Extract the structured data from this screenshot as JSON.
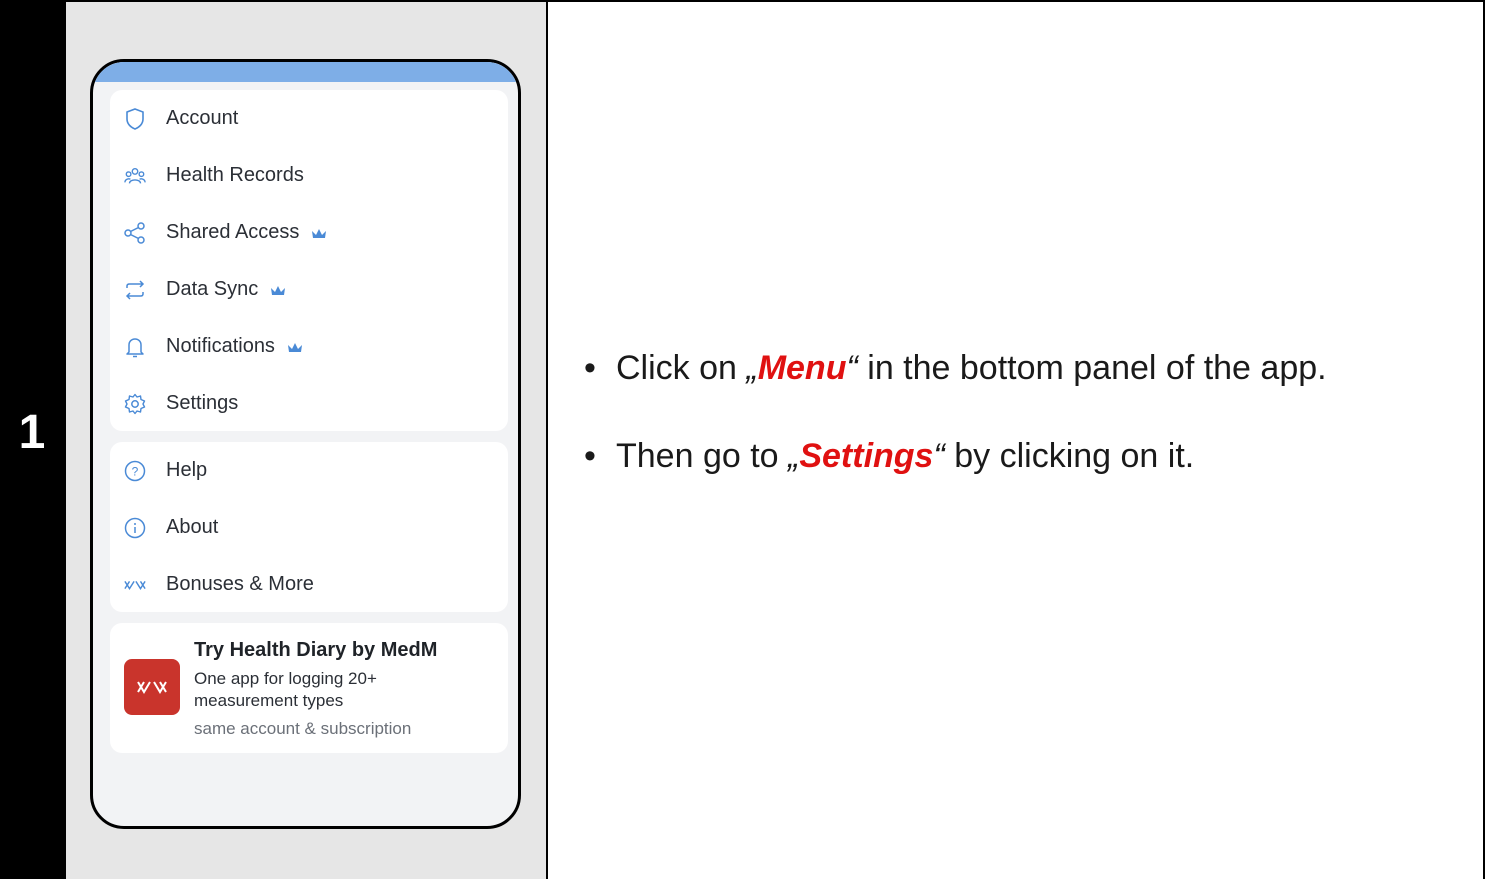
{
  "step": {
    "number": "1"
  },
  "menu": {
    "group1": [
      {
        "icon": "shield-icon",
        "label": "Account",
        "premium": false
      },
      {
        "icon": "people-icon",
        "label": "Health Records",
        "premium": false
      },
      {
        "icon": "share-icon",
        "label": "Shared Access",
        "premium": true
      },
      {
        "icon": "sync-icon",
        "label": "Data Sync",
        "premium": true
      },
      {
        "icon": "bell-icon",
        "label": "Notifications",
        "premium": true
      },
      {
        "icon": "gear-icon",
        "label": "Settings",
        "premium": false
      }
    ],
    "group2": [
      {
        "icon": "help-icon",
        "label": "Help"
      },
      {
        "icon": "info-icon",
        "label": "About"
      },
      {
        "icon": "medm-logo-icon",
        "label": "Bonuses & More"
      }
    ]
  },
  "promo": {
    "title": "Try Health Diary by MedM",
    "line1": "One app for logging 20+",
    "line2": "measurement types",
    "sub": "same account & subscription"
  },
  "instructions": {
    "bullet1": {
      "pre": "Click on ",
      "open_quote": "„",
      "highlight": "Menu",
      "close_quote": "“",
      "post": " in the bottom panel of the app."
    },
    "bullet2": {
      "pre": "Then go to ",
      "open_quote": "„",
      "highlight": "Settings",
      "close_quote": "“",
      "post": " by clicking on it."
    }
  },
  "colors": {
    "accent_blue": "#7eaee7",
    "highlight_red": "#e01111",
    "promo_red": "#c9342c"
  }
}
